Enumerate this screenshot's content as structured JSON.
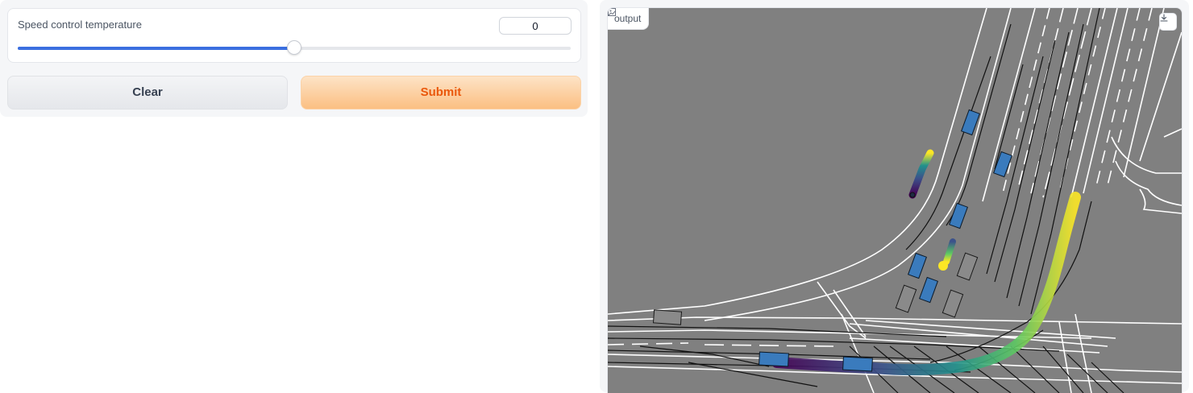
{
  "controls": {
    "slider": {
      "label": "Speed control temperature",
      "value": "0",
      "position_fraction": 0.5
    },
    "buttons": {
      "clear_label": "Clear",
      "submit_label": "Submit"
    }
  },
  "output": {
    "label": "output",
    "label_icon": "image-icon",
    "download_icon": "download-icon"
  },
  "colors": {
    "accent": "#3b6fe0",
    "submit_text": "#ea580c",
    "map_background": "#808080",
    "vehicle_fill": "#3a7bbd"
  }
}
